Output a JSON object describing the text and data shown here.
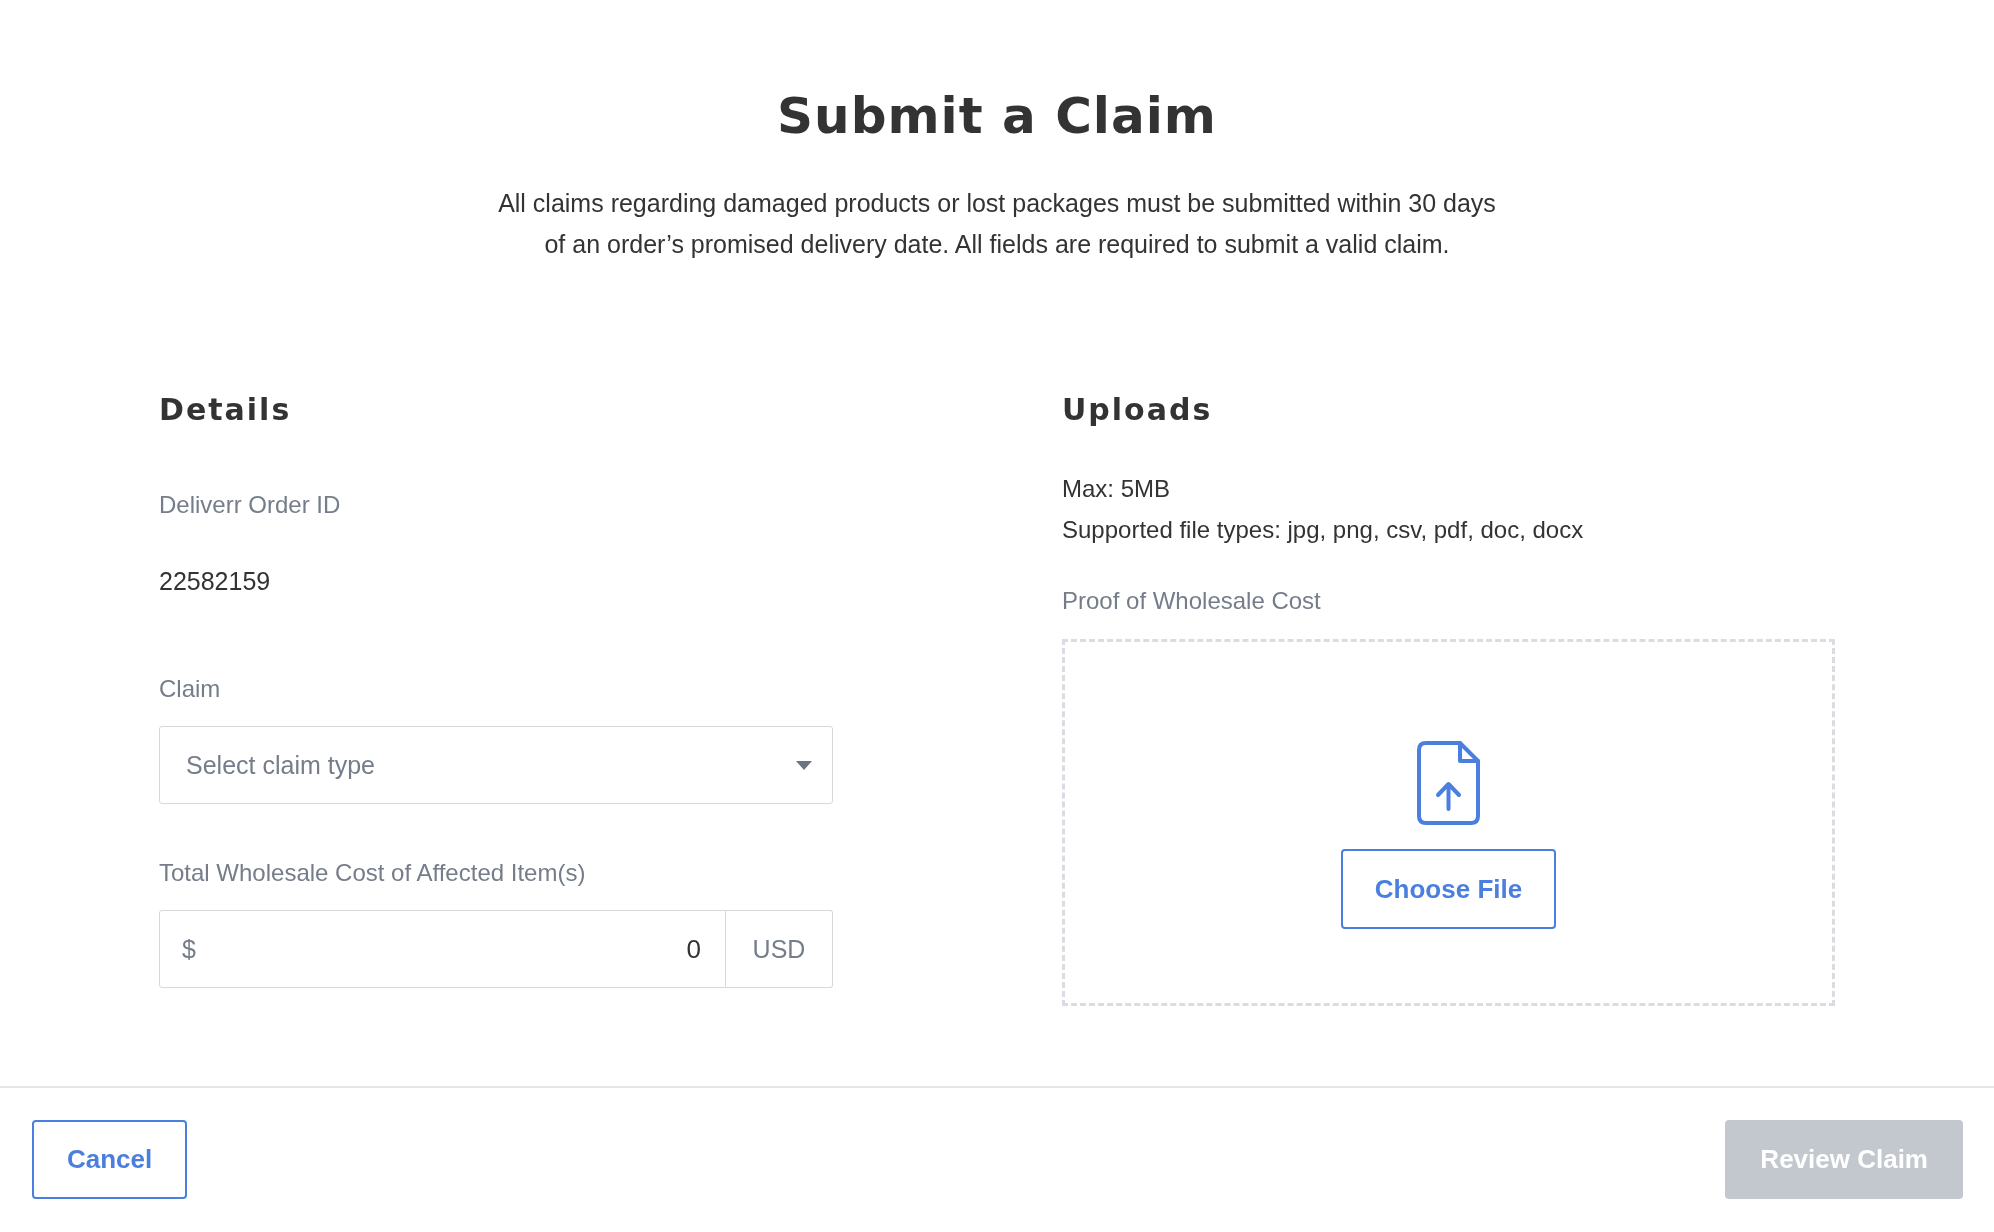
{
  "title": "Submit a Claim",
  "intro": "All claims regarding damaged products or lost packages must be submitted within 30 days of an order’s promised delivery date. All fields are required to submit a valid claim.",
  "details": {
    "heading": "Details",
    "fields": [
      {
        "kind": "static",
        "label": "Deliverr Order ID",
        "value": "22582159"
      },
      {
        "kind": "select",
        "label": "Claim",
        "placeholder": "Select claim type"
      },
      {
        "kind": "currency",
        "label": "Total Wholesale Cost of Affected Item(s)",
        "prefix": "$",
        "value": "0",
        "unit": "USD"
      }
    ]
  },
  "uploads": {
    "heading": "Uploads",
    "notes": [
      "Max: 5MB",
      "Supported file types: jpg, png, csv, pdf, doc, docx"
    ],
    "label": "Proof of Wholesale Cost",
    "button": "Choose File"
  },
  "footer": {
    "buttons": [
      {
        "kind": "secondary",
        "label": "Cancel",
        "disabled": false
      },
      {
        "kind": "primary",
        "label": "Review Claim",
        "disabled": true
      }
    ]
  }
}
